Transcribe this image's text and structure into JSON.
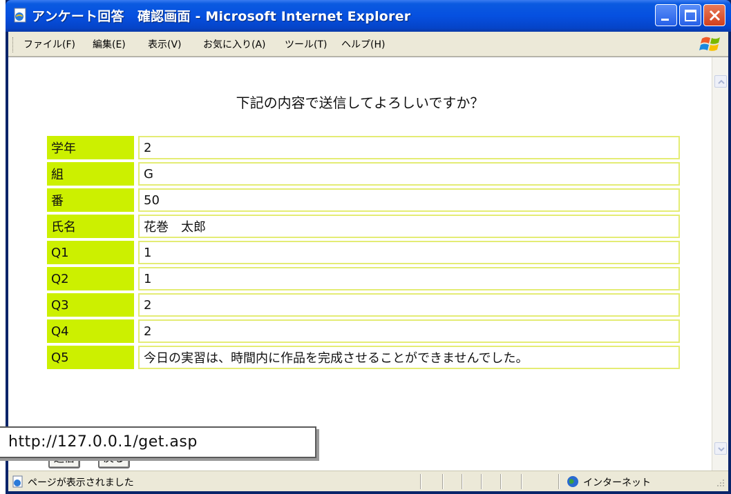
{
  "window": {
    "title": "アンケート回答　確認画面 - Microsoft Internet Explorer"
  },
  "menu": {
    "items": [
      "ファイル(F)",
      "編集(E)",
      "表示(V)",
      "お気に入り(A)",
      "ツール(T)",
      "ヘルプ(H)"
    ]
  },
  "page": {
    "heading": "下記の内容で送信してよろしいですか？",
    "rows": [
      {
        "label": "学年",
        "value": "2"
      },
      {
        "label": "組",
        "value": "G"
      },
      {
        "label": "番",
        "value": "50"
      },
      {
        "label": "氏名",
        "value": "花巻　太郎"
      },
      {
        "label": "Q1",
        "value": "1"
      },
      {
        "label": "Q2",
        "value": "1"
      },
      {
        "label": "Q3",
        "value": "2"
      },
      {
        "label": "Q4",
        "value": "2"
      },
      {
        "label": "Q5",
        "value": "今日の実習は、時間内に作品を完成させることができませんでした。"
      }
    ],
    "submit_label": "送信",
    "back_label": "戻る"
  },
  "url_overlay": "http://127.0.0.1/get.asp",
  "statusbar": {
    "status_text": "ページが表示されました",
    "zone_text": "インターネット"
  },
  "colors": {
    "label_bg": "#ccf000",
    "value_border": "#e4ec74",
    "titlebar": "#0650e0"
  }
}
